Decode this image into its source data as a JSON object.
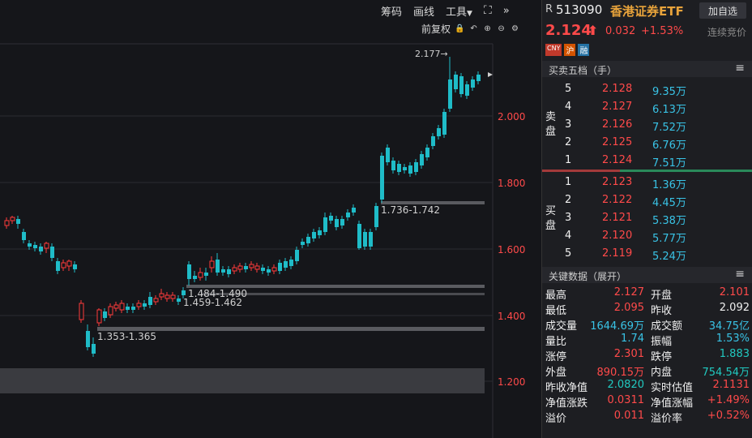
{
  "toolbar": {
    "chip_label": "筹码",
    "draw_label": "画线",
    "tools_label": "工具",
    "adjust_label": "前复权"
  },
  "chart": {
    "price_labels": [
      "2.000",
      "1.800",
      "1.600",
      "1.400",
      "1.200"
    ],
    "annotations": {
      "high": "2.177→",
      "range1": "1.736-1.742",
      "range2": "1.484-1.490",
      "range3": "1.459-1.462",
      "range4": "1.353-1.365"
    }
  },
  "quote": {
    "r_label": "R",
    "code": "513090",
    "name": "香港证券ETF",
    "add_watch_label": "加自选",
    "price": "2.124",
    "change": "0.032",
    "change_pct": "+1.53%",
    "status": "连续竞价",
    "badges": [
      "CNY",
      "沪",
      "融"
    ]
  },
  "orderbook": {
    "title": "买卖五档（手）",
    "sell_label": [
      "卖",
      "盘"
    ],
    "buy_label": [
      "买",
      "盘"
    ],
    "sells": [
      {
        "level": "5",
        "price": "2.128",
        "vol": "9.35万"
      },
      {
        "level": "4",
        "price": "2.127",
        "vol": "6.13万"
      },
      {
        "level": "3",
        "price": "2.126",
        "vol": "7.52万"
      },
      {
        "level": "2",
        "price": "2.125",
        "vol": "6.76万"
      },
      {
        "level": "1",
        "price": "2.124",
        "vol": "7.51万"
      }
    ],
    "buys": [
      {
        "level": "1",
        "price": "2.123",
        "vol": "1.36万"
      },
      {
        "level": "2",
        "price": "2.122",
        "vol": "4.45万"
      },
      {
        "level": "3",
        "price": "2.121",
        "vol": "5.38万"
      },
      {
        "level": "4",
        "price": "2.120",
        "vol": "5.77万"
      },
      {
        "level": "5",
        "price": "2.119",
        "vol": "5.24万"
      }
    ]
  },
  "keydata": {
    "title": "关键数据（展开）",
    "rows": [
      {
        "l1": "最高",
        "v1": "2.127",
        "c1": "red",
        "l2": "开盘",
        "v2": "2.101",
        "c2": "red"
      },
      {
        "l1": "最低",
        "v1": "2.095",
        "c1": "red",
        "l2": "昨收",
        "v2": "2.092",
        "c2": "white"
      },
      {
        "l1": "成交量",
        "v1": "1644.69万",
        "c1": "cyan",
        "l2": "成交额",
        "v2": "34.75亿",
        "c2": "cyan"
      },
      {
        "l1": "量比",
        "v1": "1.74",
        "c1": "cyan",
        "l2": "振幅",
        "v2": "1.53%",
        "c2": "cyan"
      },
      {
        "l1": "涨停",
        "v1": "2.301",
        "c1": "red",
        "l2": "跌停",
        "v2": "1.883",
        "c2": "green"
      },
      {
        "l1": "外盘",
        "v1": "890.15万",
        "c1": "red",
        "l2": "内盘",
        "v2": "754.54万",
        "c2": "green"
      },
      {
        "l1": "昨收净值",
        "v1": "2.0820",
        "c1": "green",
        "l2": "实时估值",
        "v2": "2.1131",
        "c2": "red"
      },
      {
        "l1": "净值涨跌",
        "v1": "0.0311",
        "c1": "red",
        "l2": "净值涨幅",
        "v2": "+1.49%",
        "c2": "red"
      },
      {
        "l1": "溢价",
        "v1": "0.011",
        "c1": "red",
        "l2": "溢价率",
        "v2": "+0.52%",
        "c2": "red"
      }
    ]
  }
}
